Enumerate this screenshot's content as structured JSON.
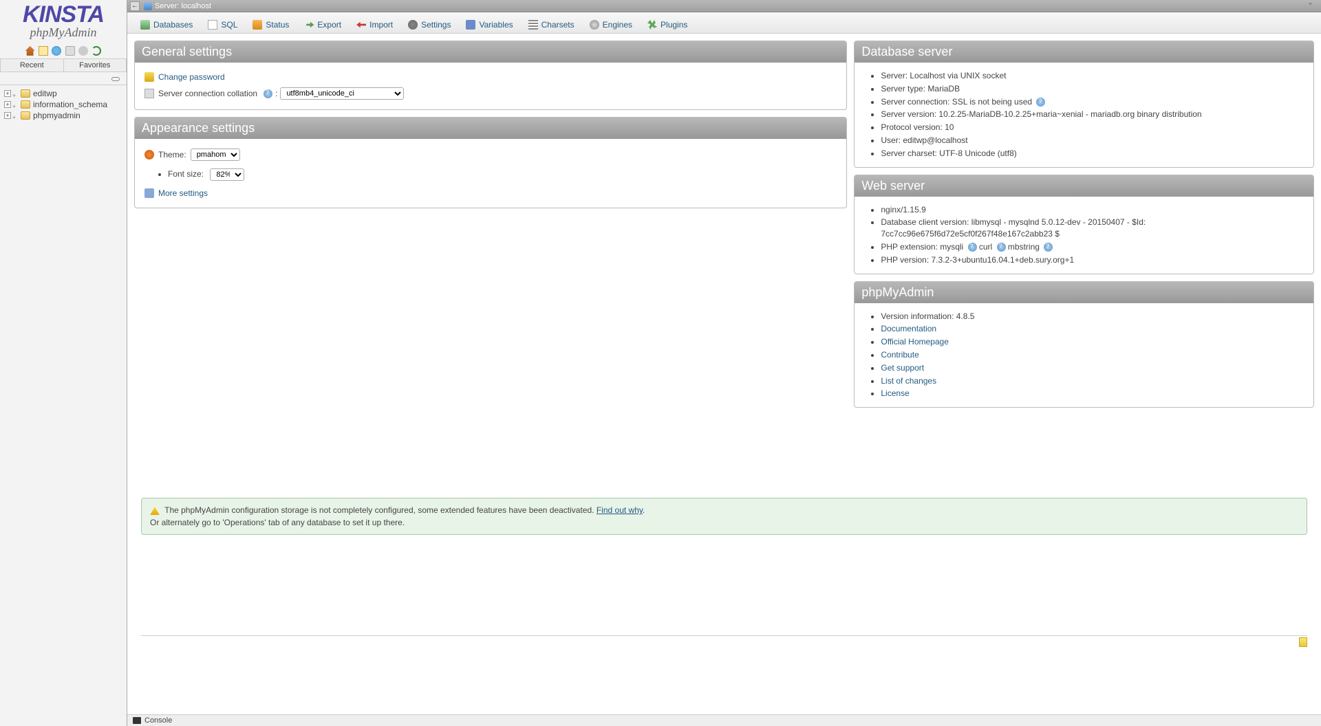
{
  "logo": {
    "brand": "KINSTA",
    "product": "phpMyAdmin"
  },
  "sidebar_tabs": {
    "recent": "Recent",
    "favorites": "Favorites"
  },
  "databases": [
    "editwp",
    "information_schema",
    "phpmyadmin"
  ],
  "breadcrumb": {
    "server_label": "Server:",
    "server_name": "localhost"
  },
  "tabs": {
    "databases": "Databases",
    "sql": "SQL",
    "status": "Status",
    "export": "Export",
    "import": "Import",
    "settings": "Settings",
    "variables": "Variables",
    "charsets": "Charsets",
    "engines": "Engines",
    "plugins": "Plugins"
  },
  "general": {
    "title": "General settings",
    "change_password": "Change password",
    "collation_label": "Server connection collation",
    "collation_value": "utf8mb4_unicode_ci"
  },
  "appearance": {
    "title": "Appearance settings",
    "theme_label": "Theme:",
    "theme_value": "pmahomme",
    "font_label": "Font size:",
    "font_value": "82%",
    "more": "More settings"
  },
  "db_server": {
    "title": "Database server",
    "items": [
      "Server: Localhost via UNIX socket",
      "Server type: MariaDB",
      "Server connection: SSL is not being used",
      "Server version: 10.2.25-MariaDB-10.2.25+maria~xenial - mariadb.org binary distribution",
      "Protocol version: 10",
      "User: editwp@localhost",
      "Server charset: UTF-8 Unicode (utf8)"
    ]
  },
  "web_server": {
    "title": "Web server",
    "items": [
      "nginx/1.15.9",
      "Database client version: libmysql - mysqlnd 5.0.12-dev - 20150407 - $Id: 7cc7cc96e675f6d72e5cf0f267f48e167c2abb23 $",
      "PHP extension: mysqli   curl   mbstring",
      "PHP version: 7.3.2-3+ubuntu16.04.1+deb.sury.org+1"
    ]
  },
  "pma": {
    "title": "phpMyAdmin",
    "version": "Version information: 4.8.5",
    "links": [
      "Documentation",
      "Official Homepage",
      "Contribute",
      "Get support",
      "List of changes",
      "License"
    ]
  },
  "notice": {
    "text": "The phpMyAdmin configuration storage is not completely configured, some extended features have been deactivated. ",
    "link": "Find out why",
    "alt": "Or alternately go to 'Operations' tab of any database to set it up there."
  },
  "console": "Console"
}
